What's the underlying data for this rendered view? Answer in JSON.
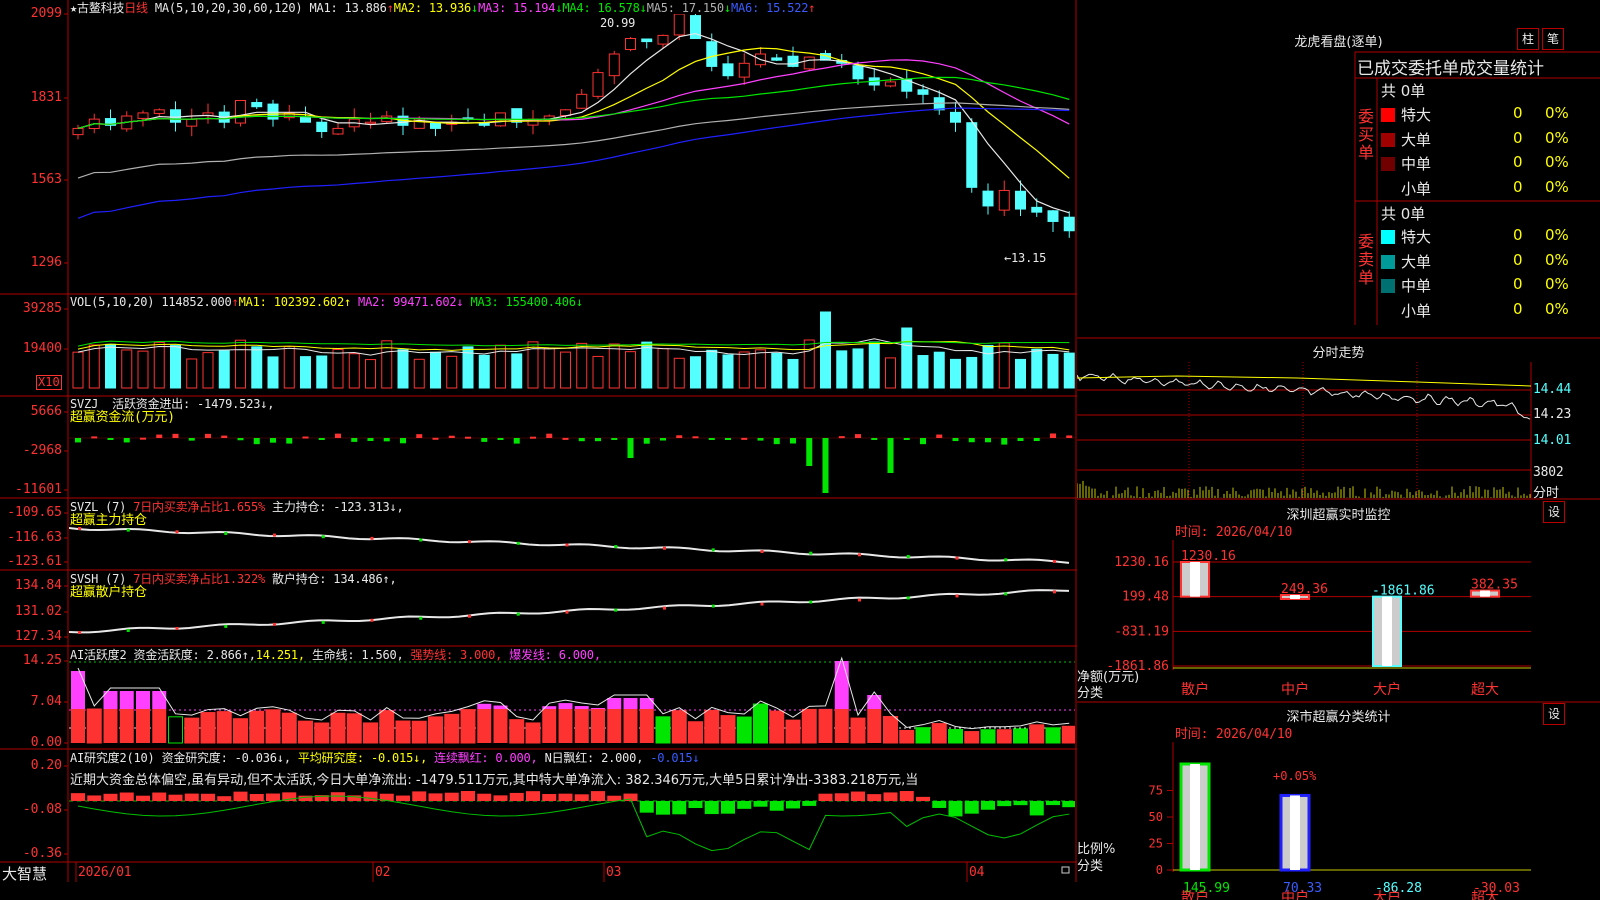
{
  "colors": {
    "up": "#ff3232",
    "down": "#54ffff",
    "grid": "#b00000",
    "ma1": "#e8e8e8",
    "ma2": "#ffff00",
    "ma3": "#ff40ff",
    "ma4": "#00e600",
    "ma5": "#b0b0b0",
    "ma6": "#2020ff"
  },
  "kline": {
    "star": "★",
    "stock_name": "古鳌科技",
    "period": "日线",
    "ma_label": "MA(5,10,20,30,60,120)",
    "ma": [
      {
        "label": "MA1: 13.886",
        "arrow": "↑"
      },
      {
        "label": "MA2: 13.936",
        "arrow": "↓"
      },
      {
        "label": "MA3: 15.194",
        "arrow": "↓"
      },
      {
        "label": "MA4: 16.578",
        "arrow": "↓"
      },
      {
        "label": "MA5: 17.150",
        "arrow": "↓"
      },
      {
        "label": "MA6: 15.522",
        "arrow": "↑"
      }
    ],
    "y_ticks": [
      "2099",
      "1831",
      "1563",
      "1296"
    ],
    "high_label": "20.99",
    "low_label": "←13.15"
  },
  "vol": {
    "label": "VOL(5,10,20)",
    "value": "114852.000",
    "arrow": "↑",
    "ma1": "MA1: 102392.602↑",
    "ma2": "MA2: 99471.602↓",
    "ma3": "MA3: 155400.406↓",
    "y_ticks": [
      "39285",
      "19400"
    ],
    "unit": "X10"
  },
  "svzj": {
    "label": "SVZJ",
    "desc": "活跃资金进出: -1479.523↓,",
    "sub": "超赢资金流(万元)",
    "y_ticks": [
      "5666",
      "-2968",
      "-11601"
    ]
  },
  "svzl": {
    "label": "SVZL (7)",
    "desc1": "7日内买卖净占比1.655%",
    "desc2": "主力持仓: -123.313↓,",
    "sub": "超赢主力持仓",
    "y_ticks": [
      "-109.65",
      "-116.63",
      "-123.61"
    ]
  },
  "svsh": {
    "label": "SVSH (7)",
    "desc1": "7日内买卖净占比1.322%",
    "desc2": "散户持仓: 134.486↑,",
    "sub": "超赢散户持仓",
    "y_ticks": [
      "134.84",
      "131.02",
      "127.34"
    ]
  },
  "ai1": {
    "label": "AI活跃度2",
    "desc1": "资金活跃度: 2.866↑,",
    "desc2": "14.251,",
    "desc3": "生命线: 1.560,",
    "desc4": "强势线: 3.000,",
    "desc5": "爆发线: 6.000,",
    "y_ticks": [
      "14.25",
      "7.04",
      "0.00"
    ]
  },
  "ai2": {
    "label": "AI研究度2(10)",
    "desc1": "资金研究度: -0.036↓,",
    "desc2": "平均研究度: -0.015↓,",
    "desc3": "连续飘红: 0.000,",
    "desc4": "N日飘红: 2.000,",
    "desc5": "-0.015↓",
    "comment": "近期大资金总体偏空,虽有异动,但不太活跃,今日大单净流出: -1479.511万元,其中特大单净流入: 382.346万元,大单5日累计净出-3383.218万元,当",
    "y_ticks": [
      "0.20",
      "-0.08",
      "-0.36"
    ]
  },
  "bottom": {
    "brand": "大智慧",
    "dates": [
      "2026/01",
      "02",
      "03",
      "04"
    ]
  },
  "dragon": {
    "title": "龙虎看盘(逐单)",
    "btn_bar": "柱",
    "btn_line": "笔",
    "heading": "已成交委托单成交量统计",
    "buy_label": [
      "委",
      "买",
      "单"
    ],
    "sell_label": [
      "委",
      "卖",
      "单"
    ],
    "buy_total": "共 0单",
    "sell_total": "共 0单",
    "buy_rows": [
      {
        "name": "特大",
        "count": "0",
        "pct": "0%",
        "color": "#ff0000"
      },
      {
        "name": "大单",
        "count": "0",
        "pct": "0%",
        "color": "#a00000"
      },
      {
        "name": "中单",
        "count": "0",
        "pct": "0%",
        "color": "#700000"
      },
      {
        "name": "小单",
        "count": "0",
        "pct": "0%",
        "color": ""
      }
    ],
    "sell_rows": [
      {
        "name": "特大",
        "count": "0",
        "pct": "0%",
        "color": "#00ffff"
      },
      {
        "name": "大单",
        "count": "0",
        "pct": "0%",
        "color": "#009a9a"
      },
      {
        "name": "中单",
        "count": "0",
        "pct": "0%",
        "color": "#007070"
      },
      {
        "name": "小单",
        "count": "0",
        "pct": "0%",
        "color": ""
      }
    ]
  },
  "intraday": {
    "title": "分时走势",
    "y_ticks": [
      "14.44",
      "14.23",
      "14.01"
    ],
    "vol_tick": "3802",
    "vol_unit": "分时"
  },
  "monitor": {
    "title": "深圳超赢实时监控",
    "btn": "设",
    "time": "时间: 2026/04/10",
    "y_ticks": [
      "1230.16",
      "199.48",
      "-831.19",
      "-1861.86"
    ],
    "ylabel1": "净额(万元)",
    "ylabel2": "分类",
    "chart_data": {
      "type": "bar",
      "categories": [
        "散户",
        "中户",
        "大户",
        "超大"
      ],
      "values": [
        1230.16,
        249.36,
        -1861.86,
        382.35
      ],
      "ylim": [
        -1861.86,
        1230.16
      ]
    }
  },
  "classify": {
    "title": "深市超赢分类统计",
    "btn": "设",
    "time": "时间: 2026/04/10",
    "y_ticks": [
      "75",
      "50",
      "25",
      "0"
    ],
    "ylabel1": "比例%",
    "ylabel2": "分类",
    "pct_label": "+0.05%",
    "chart_data": {
      "type": "bar",
      "categories": [
        "散户",
        "中户",
        "大户",
        "超大"
      ],
      "values": [
        145.99,
        70.33,
        -86.28,
        -30.03
      ],
      "ylim": [
        0,
        100
      ]
    }
  }
}
